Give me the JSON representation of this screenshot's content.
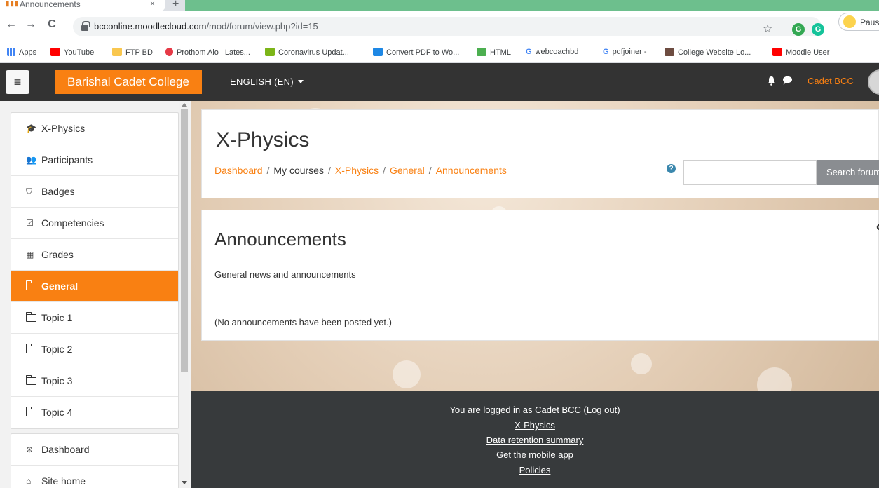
{
  "browser": {
    "tab_title": "Announcements",
    "tab_close": "×",
    "new_tab": "+",
    "url_domain": "bcconline.moodlecloud.com",
    "url_path": "/mod/forum/view.php?id=15",
    "profile_label": "Paus",
    "back": "←",
    "forward": "→",
    "reload": "C",
    "star": "☆",
    "ext1": "G",
    "ext2": "G",
    "bookmarks": [
      {
        "label": "Apps",
        "color": "#ea4335"
      },
      {
        "label": "YouTube",
        "color": "#ff0000"
      },
      {
        "label": "FTP BD",
        "color": "#f9c74f"
      },
      {
        "label": "Prothom Alo | Lates...",
        "color": "#e63946"
      },
      {
        "label": "Coronavirus Updat...",
        "color": "#7cb518"
      },
      {
        "label": "Convert PDF to Wo...",
        "color": "#1e88e5"
      },
      {
        "label": "HTML",
        "color": "#4caf50"
      },
      {
        "label": "webcoachbd",
        "color": "#4285f4"
      },
      {
        "label": "pdfjoiner -",
        "color": "#4285f4"
      },
      {
        "label": "College Website Lo...",
        "color": "#6d4c41"
      },
      {
        "label": "Moodle User",
        "color": "#ff0000"
      }
    ]
  },
  "navbar": {
    "menu_icon": "≡",
    "brand": "Barishal Cadet College",
    "language": "ENGLISH (EN)",
    "username": "Cadet BCC",
    "bell": "🔔",
    "chat": "💬"
  },
  "sidebar": {
    "course_items": [
      {
        "label": "X-Physics",
        "icon": "graduation-cap-icon",
        "glyph": "🎓"
      },
      {
        "label": "Participants",
        "icon": "users-icon",
        "glyph": "👥"
      },
      {
        "label": "Badges",
        "icon": "shield-icon",
        "glyph": "⛉"
      },
      {
        "label": "Competencies",
        "icon": "check-square-icon",
        "glyph": "☑"
      },
      {
        "label": "Grades",
        "icon": "table-icon",
        "glyph": "▦"
      },
      {
        "label": "General",
        "icon": "folder-icon",
        "glyph": ""
      },
      {
        "label": "Topic 1",
        "icon": "folder-icon",
        "glyph": ""
      },
      {
        "label": "Topic 2",
        "icon": "folder-icon",
        "glyph": ""
      },
      {
        "label": "Topic 3",
        "icon": "folder-icon",
        "glyph": ""
      },
      {
        "label": "Topic 4",
        "icon": "folder-icon",
        "glyph": ""
      }
    ],
    "site_items": [
      {
        "label": "Dashboard",
        "icon": "dashboard-icon",
        "glyph": "⊛"
      },
      {
        "label": "Site home",
        "icon": "home-icon",
        "glyph": "⌂"
      }
    ]
  },
  "header": {
    "course_title": "X-Physics",
    "breadcrumb": {
      "dashboard": "Dashboard",
      "my_courses": "My courses",
      "course": "X-Physics",
      "section": "General",
      "activity": "Announcements",
      "separator": "/"
    },
    "help": "?",
    "search_button": "Search forums"
  },
  "forum": {
    "title": "Announcements",
    "description": "General news and announcements",
    "empty_message": "(No announcements have been posted yet.)"
  },
  "footer": {
    "logged_in_prefix": "You are logged in as",
    "user": "Cadet BCC",
    "logout_open": "(",
    "logout": "Log out",
    "logout_close": ")",
    "course_link": "X-Physics",
    "data_retention": "Data retention summary",
    "mobile_app": "Get the mobile app",
    "policies": "Policies"
  },
  "colors": {
    "brand_orange": "#f98012",
    "navbar_dark": "#333333",
    "footer_dark": "#373a3c",
    "active_item": "#f98012"
  }
}
